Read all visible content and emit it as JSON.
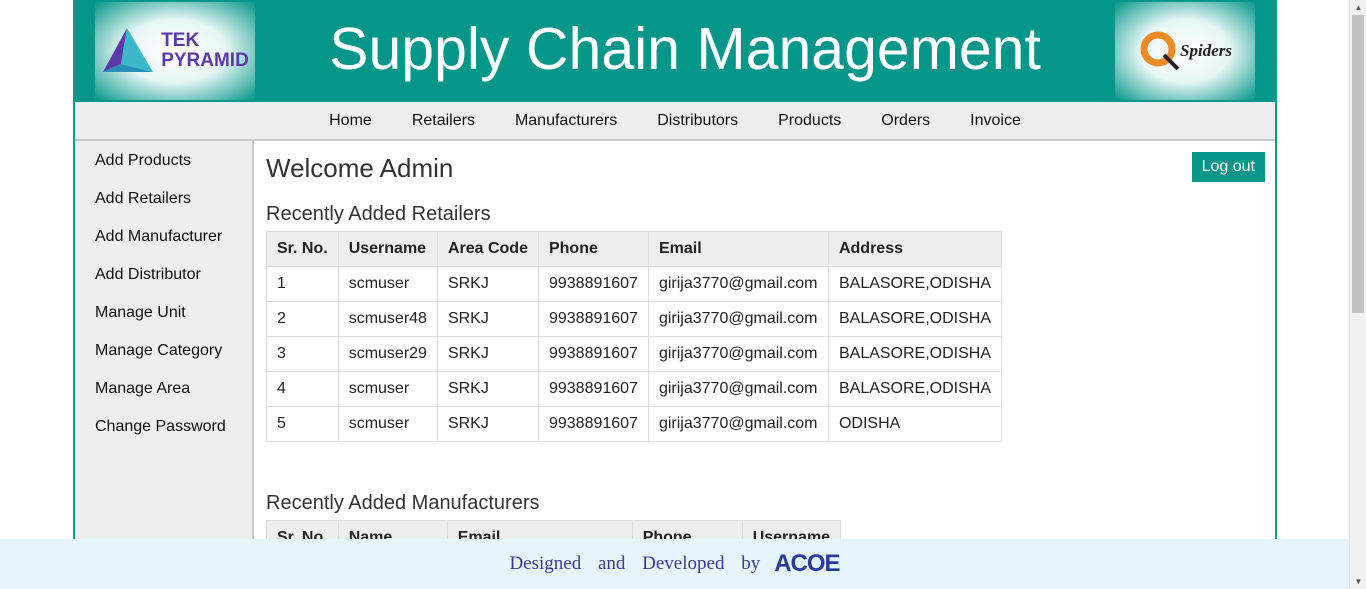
{
  "header": {
    "title": "Supply Chain Management",
    "left_logo": "TEK PYRAMID",
    "left_logo_line1": "TEK",
    "left_logo_line2": "PYRAMID",
    "right_logo": "Spiders"
  },
  "nav": [
    "Home",
    "Retailers",
    "Manufacturers",
    "Distributors",
    "Products",
    "Orders",
    "Invoice"
  ],
  "sidebar": [
    "Add Products",
    "Add Retailers",
    "Add Manufacturer",
    "Add Distributor",
    "Manage Unit",
    "Manage Category",
    "Manage Area",
    "Change Password"
  ],
  "main": {
    "welcome": "Welcome Admin",
    "logout_label": "Log out",
    "retailers": {
      "title": "Recently Added Retailers",
      "columns": [
        "Sr. No.",
        "Username",
        "Area Code",
        "Phone",
        "Email",
        "Address"
      ],
      "rows": [
        [
          "1",
          "scmuser",
          "SRKJ",
          "9938891607",
          "girija3770@gmail.com",
          "BALASORE,ODISHA"
        ],
        [
          "2",
          "scmuser48",
          "SRKJ",
          "9938891607",
          "girija3770@gmail.com",
          "BALASORE,ODISHA"
        ],
        [
          "3",
          "scmuser29",
          "SRKJ",
          "9938891607",
          "girija3770@gmail.com",
          "BALASORE,ODISHA"
        ],
        [
          "4",
          "scmuser",
          "SRKJ",
          "9938891607",
          "girija3770@gmail.com",
          "BALASORE,ODISHA"
        ],
        [
          "5",
          "scmuser",
          "SRKJ",
          "9938891607",
          "girija3770@gmail.com",
          "ODISHA"
        ]
      ]
    },
    "manufacturers": {
      "title": "Recently Added Manufacturers",
      "columns": [
        "Sr. No.",
        "Name",
        "Email",
        "Phone",
        "Username"
      ]
    }
  },
  "footer": {
    "text": "Designed and Developed by",
    "logo": "ACOE"
  },
  "colors": {
    "header": "#05968a",
    "nav_bg": "#eeeeee",
    "logout_bg": "#05968a",
    "footer_bg": "#e6f4fb"
  }
}
